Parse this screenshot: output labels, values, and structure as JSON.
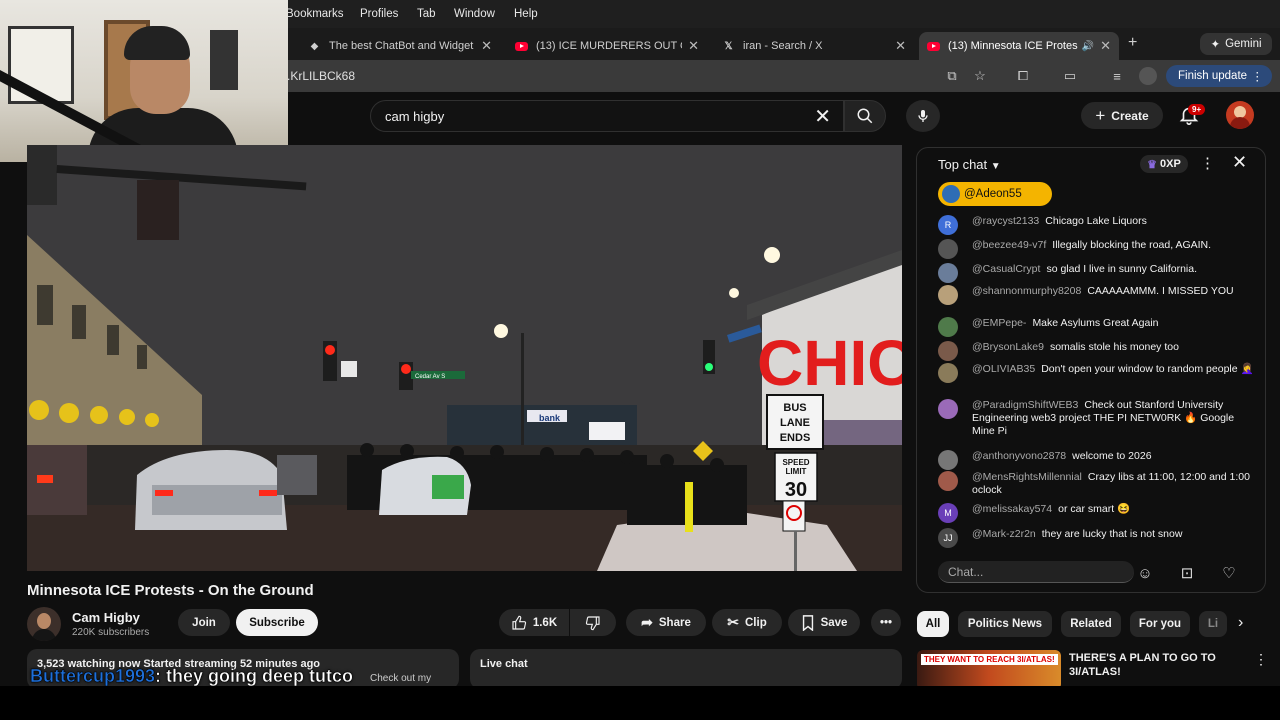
{
  "menubar": {
    "items": [
      "Bookmarks",
      "Profiles",
      "Tab",
      "Window",
      "Help"
    ]
  },
  "tabs": [
    {
      "title": "The best ChatBot and Widget",
      "icon": "chatbot-icon",
      "active": false
    },
    {
      "title": "(13) ICE MURDERERS OUT O",
      "icon": "youtube-icon",
      "active": false
    },
    {
      "title": "iran - Search / X",
      "icon": "x-icon",
      "active": false
    },
    {
      "title": "(13) Minnesota ICE Protes",
      "icon": "youtube-icon",
      "active": true
    }
  ],
  "gemini_label": "Gemini",
  "address": {
    "url_fragment": ".KrLILBCk68",
    "finish_update": "Finish update"
  },
  "youtube": {
    "search_value": "cam higby",
    "create_label": "Create",
    "notif_count": "9+"
  },
  "video": {
    "title": "Minnesota ICE Protests - On the Ground",
    "sign_chic": "CHIC",
    "bus_sign": [
      "BUS",
      "LANE",
      "ENDS"
    ],
    "speed_sign": [
      "SPEED",
      "LIMIT",
      "30"
    ],
    "street_sign": "Lake St",
    "street_sign2": "Cedar Av S",
    "bank": "bank"
  },
  "channel": {
    "name": "Cam Higby",
    "subscribers": "220K subscribers",
    "join": "Join",
    "subscribe": "Subscribe"
  },
  "actions": {
    "likes": "1.6K",
    "share": "Share",
    "clip": "Clip",
    "save": "Save"
  },
  "description": {
    "stats": "3,523 watching now  Started streaming 52 minutes ago",
    "snippet": "Check out my"
  },
  "livechat_label": "Live chat",
  "caption": {
    "user": "Buttercup1993",
    "text": ": they going deep tutco"
  },
  "chat": {
    "mode": "Top chat",
    "xp": "0XP",
    "pinned_user": "@Adeon55",
    "input_placeholder": "Chat...",
    "messages": [
      {
        "user": "@raycyst2133",
        "text": "Chicago Lake Liquors",
        "avatar": "R",
        "color": "#3f6fd8"
      },
      {
        "user": "@beezee49-v7f",
        "text": "Illegally blocking the road, AGAIN.",
        "avatar": "",
        "color": "#555555"
      },
      {
        "user": "@CasualCrypt",
        "text": "so glad I live in sunny California.",
        "avatar": "",
        "color": "#6a7d9a"
      },
      {
        "user": "@shannonmurphy8208",
        "text": "CAAAAAMMM. I MISSED YOU",
        "avatar": "",
        "color": "#b8a07a"
      },
      {
        "user": "@EMPepe-",
        "text": "Make Asylums Great Again",
        "avatar": "",
        "color": "#4f7a4a"
      },
      {
        "user": "@BrysonLake9",
        "text": "somalis stole his money too",
        "avatar": "",
        "color": "#7a5a4a"
      },
      {
        "user": "@OLIVIAB35",
        "text": "Don't open your window to random people 🤦‍♀️",
        "avatar": "",
        "color": "#8a7b5a"
      },
      {
        "user": "@ParadigmShiftWEB3",
        "text": "Check out Stanford University Engineering web3 project THE PI NETW0RK 🔥 Google Mine Pi",
        "avatar": "",
        "color": "#9a6ab8"
      },
      {
        "user": "@anthonyvono2878",
        "text": "welcome to 2026",
        "avatar": "",
        "color": "#777777"
      },
      {
        "user": "@MensRightsMillennial",
        "text": "Crazy libs at 11:00, 12:00 and 1:00 oclock",
        "avatar": "",
        "color": "#a05a4a"
      },
      {
        "user": "@melissakay574",
        "text": "or car smart 😆",
        "avatar": "M",
        "color": "#6a3fb8"
      },
      {
        "user": "@Mark-z2r2n",
        "text": "they are lucky that is not snow",
        "avatar": "JJ",
        "color": "#4a4a4a"
      }
    ]
  },
  "chips": [
    "All",
    "Politics News",
    "Related",
    "For you",
    "Li"
  ],
  "related": {
    "title": "THERE'S A PLAN TO GO TO 3I/ATLAS!",
    "thumb_text": "THEY WANT TO REACH 3I/ATLAS!"
  }
}
